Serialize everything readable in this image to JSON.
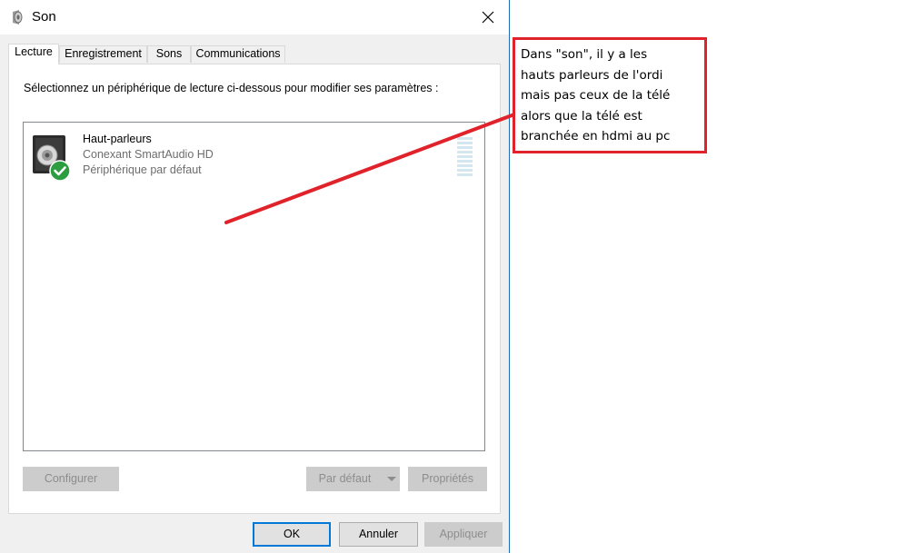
{
  "window": {
    "title": "Son",
    "close_glyph": "✕"
  },
  "tabs": [
    {
      "label": "Lecture",
      "active": true
    },
    {
      "label": "Enregistrement",
      "active": false
    },
    {
      "label": "Sons",
      "active": false
    },
    {
      "label": "Communications",
      "active": false
    }
  ],
  "panel": {
    "instruction": "Sélectionnez un périphérique de lecture ci-dessous pour modifier ses paramètres :"
  },
  "devices": [
    {
      "name": "Haut-parleurs",
      "driver": "Conexant SmartAudio HD",
      "status": "Périphérique par défaut",
      "icon": "speaker-icon",
      "badge": "default-check-icon"
    }
  ],
  "panel_buttons": {
    "configure": "Configurer",
    "set_default": "Par défaut",
    "properties": "Propriétés"
  },
  "dialog_buttons": {
    "ok": "OK",
    "cancel": "Annuler",
    "apply": "Appliquer"
  },
  "annotation": {
    "lines": [
      "Dans \"son\", il y a les",
      "hauts parleurs de l'ordi",
      "mais pas ceux de la télé",
      "alors que la télé est",
      "branchée en hdmi au pc"
    ],
    "border_color": "#e0222b",
    "arrow_color": "#e0222b"
  },
  "colors": {
    "accent": "#0078d7",
    "check_badge": "#2c9e3f"
  }
}
